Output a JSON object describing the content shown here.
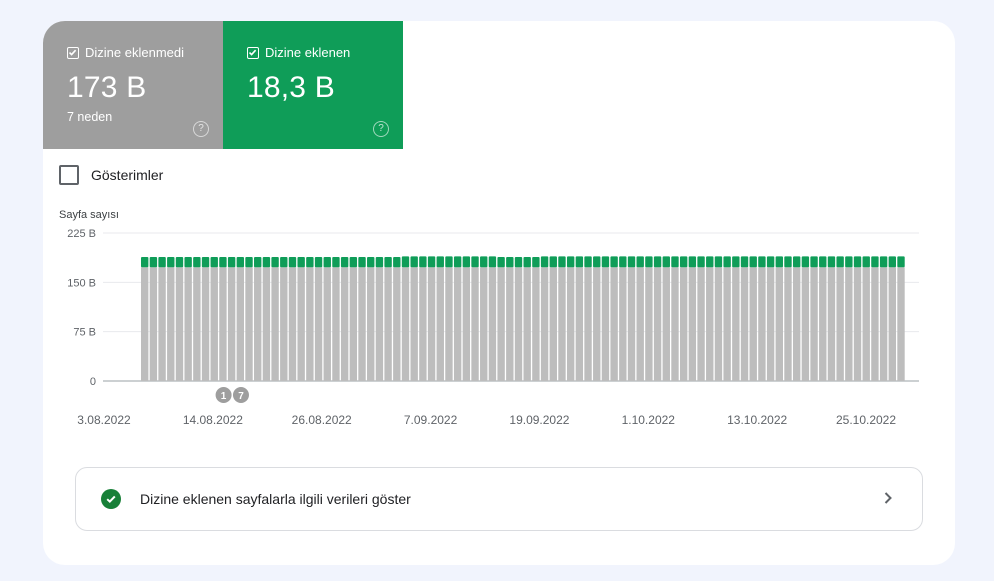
{
  "tiles": {
    "not_indexed": {
      "label": "Dizine eklenmedi",
      "value": "173 B",
      "sub": "7 neden",
      "help": "?"
    },
    "indexed": {
      "label": "Dizine eklenen",
      "value": "18,3 B",
      "help": "?"
    }
  },
  "impressions": {
    "label": "Gösterimler",
    "checked": false
  },
  "colors": {
    "not_indexed": "#9e9e9e",
    "indexed": "#0f9d58",
    "bar_grey": "#bdbdbd",
    "bar_green": "#0f9d58"
  },
  "chart_data": {
    "type": "bar",
    "stacked": true,
    "ylabel": "Sayfa sayısı",
    "ylim": [
      0,
      225000
    ],
    "yticks": [
      {
        "value": 0,
        "label": "0"
      },
      {
        "value": 75000,
        "label": "75 B"
      },
      {
        "value": 150000,
        "label": "150 B"
      },
      {
        "value": 225000,
        "label": "225 B"
      }
    ],
    "x_tick_labels": [
      "3.08.2022",
      "14.08.2022",
      "26.08.2022",
      "7.09.2022",
      "19.09.2022",
      "1.10.2022",
      "13.10.2022",
      "25.10.2022"
    ],
    "series": [
      {
        "name": "Dizine eklenmedi",
        "color": "#bdbdbd",
        "values": [
          173000,
          173000,
          173000,
          173000,
          173000,
          173000,
          173000,
          173000,
          173000,
          173000,
          173000,
          173000,
          173000,
          173000,
          173000,
          173000,
          173000,
          173000,
          173000,
          173000,
          173000,
          173000,
          173000,
          173000,
          173000,
          173000,
          173000,
          173000,
          173000,
          173000,
          173000,
          173000,
          173000,
          173000,
          173000,
          173000,
          173000,
          173000,
          173000,
          173000,
          173000,
          173000,
          173000,
          173000,
          173000,
          173000,
          173000,
          173000,
          173000,
          173000,
          173000,
          173000,
          173000,
          173000,
          173000,
          173000,
          173000,
          173000,
          173000,
          173000,
          173000,
          173000,
          173000,
          173000,
          173000,
          173000,
          173000,
          173000,
          173000,
          173000,
          173000,
          173000,
          173000,
          173000,
          173000,
          173000,
          173000,
          173000,
          173000,
          173000,
          173000,
          173000,
          173000,
          173000,
          173000,
          173000,
          173000,
          173000
        ]
      },
      {
        "name": "Dizine eklenen",
        "color": "#0f9d58",
        "values": [
          15500,
          15500,
          15500,
          15500,
          15500,
          15500,
          15500,
          15500,
          15500,
          15500,
          15500,
          15500,
          15500,
          15500,
          15500,
          15500,
          15500,
          15500,
          15500,
          15500,
          15500,
          15500,
          15500,
          15500,
          15500,
          15500,
          15500,
          15500,
          15500,
          15500,
          16500,
          16500,
          16500,
          16500,
          16500,
          16500,
          16500,
          16500,
          16500,
          16500,
          16500,
          15500,
          15500,
          15500,
          15500,
          15500,
          16500,
          16500,
          16500,
          16500,
          16500,
          16500,
          16500,
          16500,
          16500,
          16500,
          16500,
          16500,
          16500,
          16500,
          16500,
          16500,
          16500,
          16500,
          16500,
          16500,
          16500,
          16500,
          16500,
          16500,
          16500,
          16500,
          16500,
          16500,
          16500,
          16500,
          16500,
          16500,
          16500,
          16500,
          16500,
          16500,
          16500,
          16500,
          16500,
          16500,
          16500,
          16500
        ]
      }
    ],
    "annotations": [
      {
        "label": "1",
        "index": 9
      },
      {
        "label": "7",
        "index": 11
      }
    ]
  },
  "detail_link": {
    "label": "Dizine eklenen sayfalarla ilgili verileri göster"
  }
}
